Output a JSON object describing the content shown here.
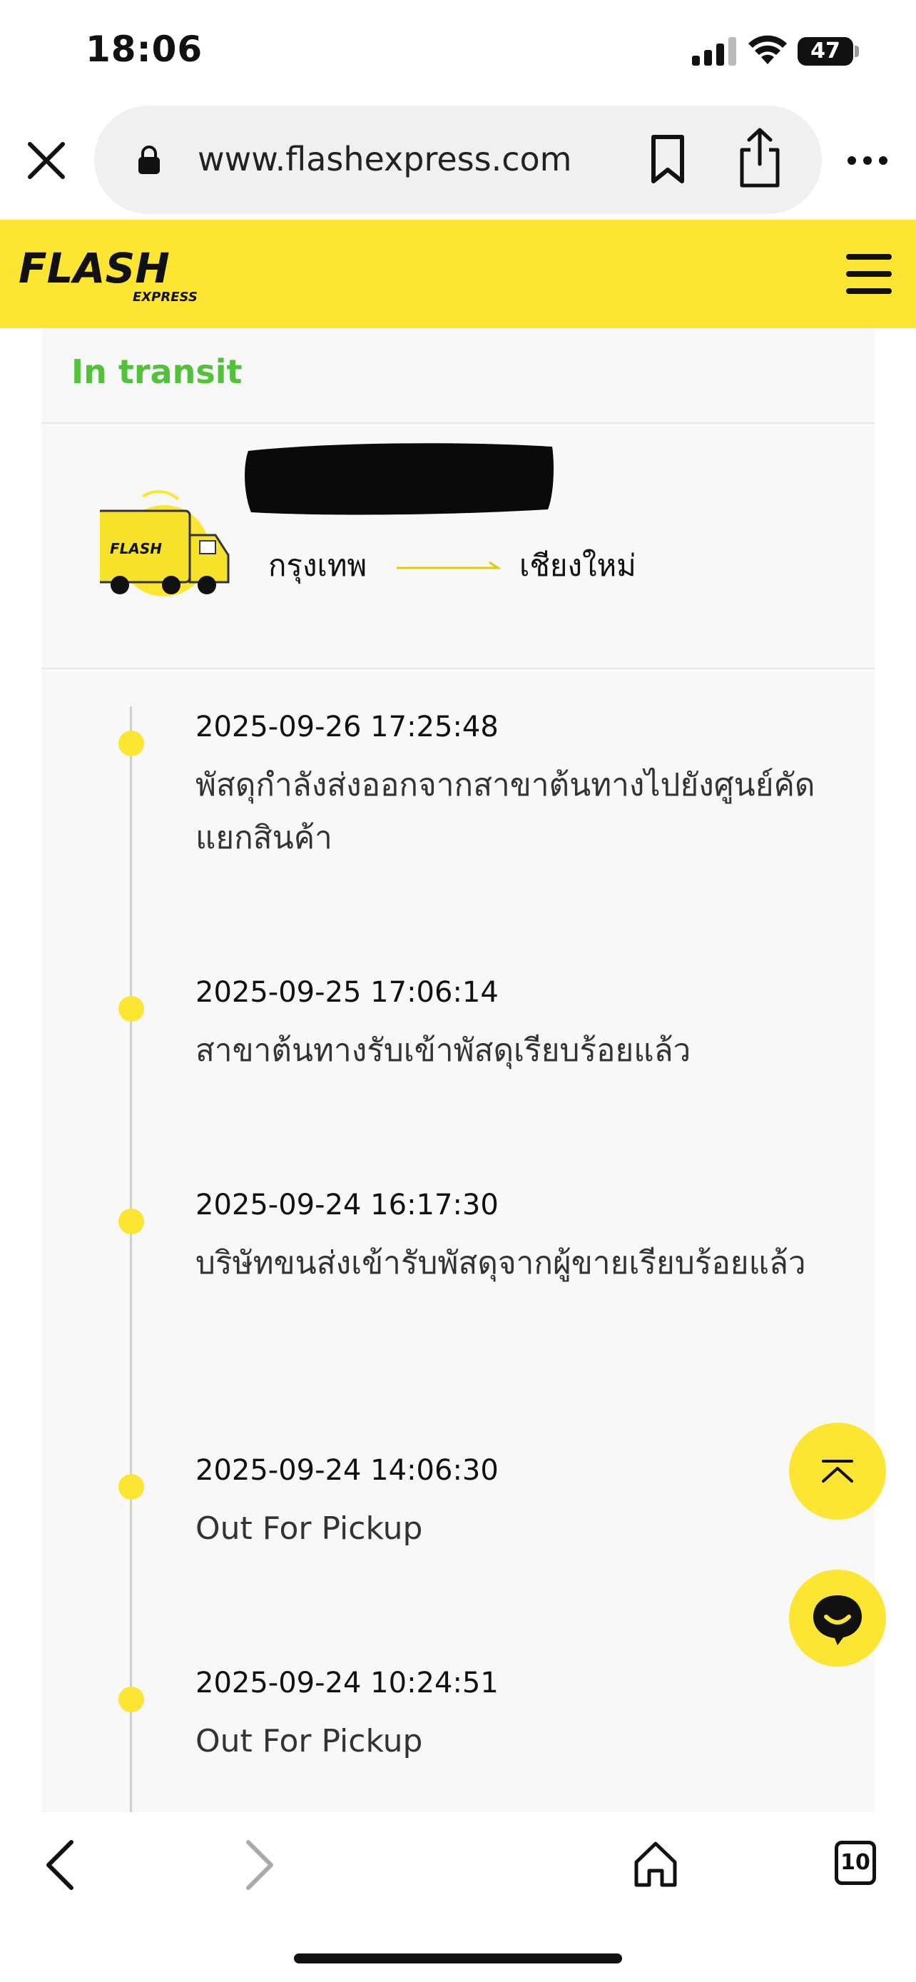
{
  "status_bar": {
    "time": "18:06",
    "battery": "47"
  },
  "browser": {
    "url": "www.flashexpress.com"
  },
  "brand": {
    "logo_word": "FLASH",
    "logo_sub": "EXPRESS",
    "accent": "#fde633"
  },
  "shipment": {
    "status": "In transit",
    "status_color": "#52c23a",
    "origin": "กรุงเทพ",
    "destination": "เชียงใหม่"
  },
  "timeline": [
    {
      "time": "2025-09-26 17:25:48",
      "desc": "พัสดุกำลังส่งออกจากสาขาต้นทางไปยังศูนย์คัดแยกสินค้า"
    },
    {
      "time": "2025-09-25 17:06:14",
      "desc": "สาขาต้นทางรับเข้าพัสดุเรียบร้อยแล้ว"
    },
    {
      "time": "2025-09-24 16:17:30",
      "desc": "บริษัทขนส่งเข้ารับพัสดุจากผู้ขายเรียบร้อยแล้ว"
    },
    {
      "time": "2025-09-24 14:06:30",
      "desc": "Out For Pickup"
    },
    {
      "time": "2025-09-24 10:24:51",
      "desc": "Out For Pickup"
    }
  ],
  "bottom_nav": {
    "tab_count": "10"
  }
}
